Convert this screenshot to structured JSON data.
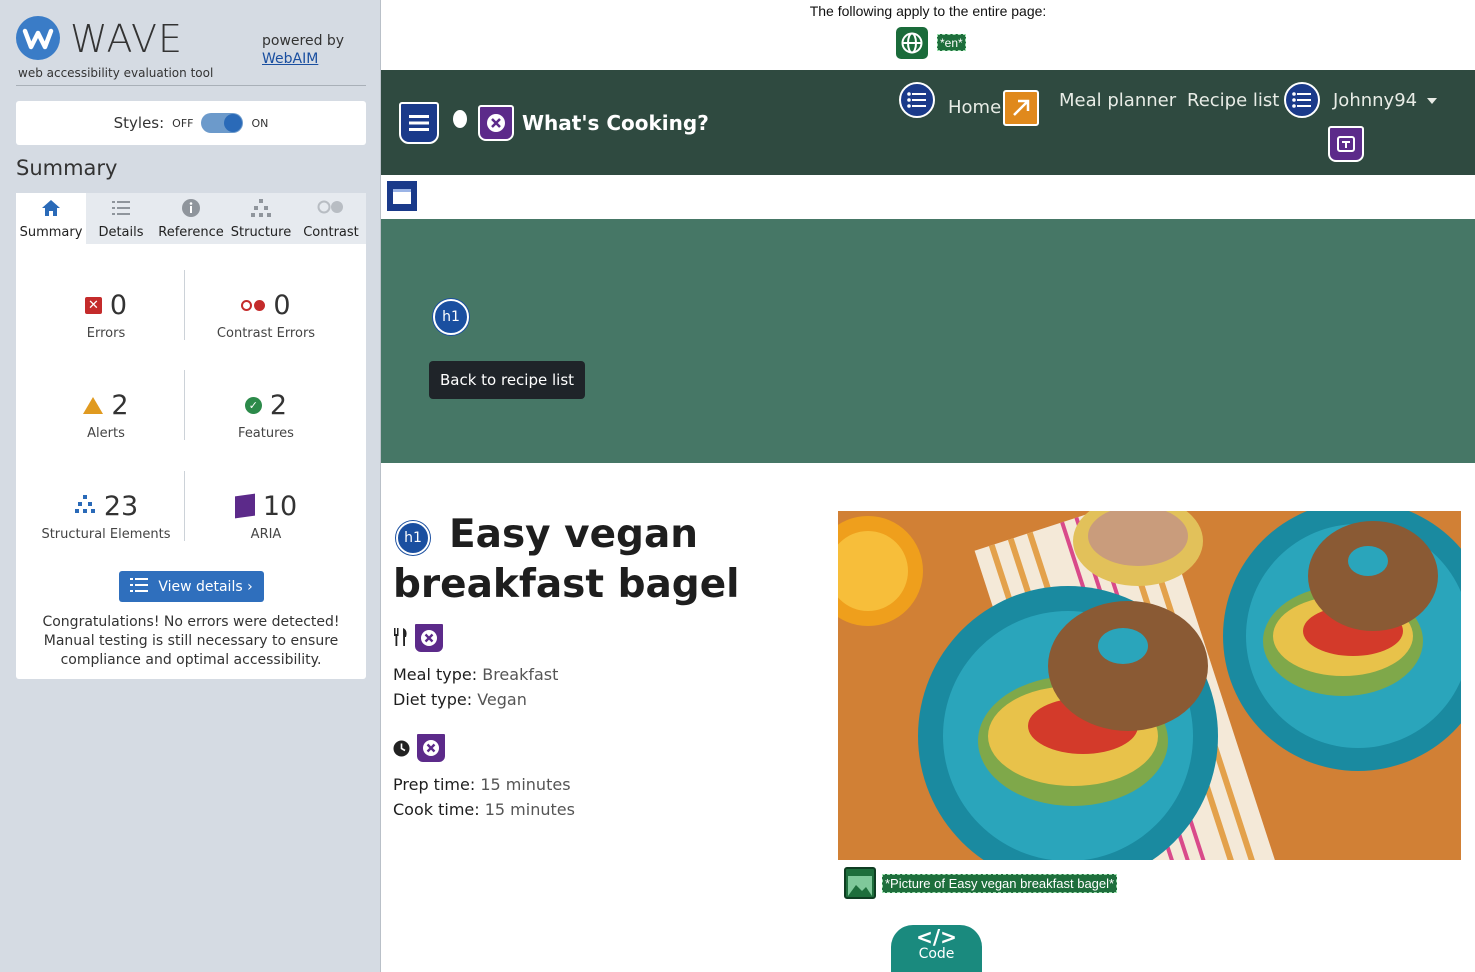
{
  "wave": {
    "logo_word": "WAVE",
    "logo_sub": "web accessibility evaluation tool",
    "powered_by": "powered by",
    "webaim_link": "WebAIM",
    "styles_label": "Styles:",
    "toggle_off": "OFF",
    "toggle_on": "ON",
    "summary_title": "Summary",
    "tabs": [
      {
        "label": "Summary",
        "icon": "home-icon",
        "active": true
      },
      {
        "label": "Details",
        "icon": "list-icon"
      },
      {
        "label": "Reference",
        "icon": "info-icon"
      },
      {
        "label": "Structure",
        "icon": "hierarchy-icon"
      },
      {
        "label": "Contrast",
        "icon": "contrast-icon"
      }
    ],
    "stats": {
      "errors": {
        "value": "0",
        "label": "Errors"
      },
      "contrast_errors": {
        "value": "0",
        "label": "Contrast Errors"
      },
      "alerts": {
        "value": "2",
        "label": "Alerts"
      },
      "features": {
        "value": "2",
        "label": "Features"
      },
      "structural": {
        "value": "23",
        "label": "Structural Elements"
      },
      "aria": {
        "value": "10",
        "label": "ARIA"
      }
    },
    "view_details": "View details ›",
    "congrats": "Congratulations! No errors were detected! Manual testing is still necessary to ensure compliance and optimal accessibility."
  },
  "page": {
    "apply_text": "The following apply to the entire page:",
    "lang_tag": "*en*",
    "brand": "What's Cooking?",
    "nav": {
      "home": "Home",
      "meal_planner": "Meal planner",
      "recipe_list": "Recipe list",
      "user": "Johnny94"
    },
    "back_button": "Back to recipe list",
    "h1_badge": "h1",
    "title": "Easy vegan breakfast bagel",
    "meal_type_label": "Meal type:",
    "meal_type_value": "Breakfast",
    "diet_type_label": "Diet type:",
    "diet_type_value": "Vegan",
    "prep_time_label": "Prep time:",
    "prep_time_value": "15 minutes",
    "cook_time_label": "Cook time:",
    "cook_time_value": "15 minutes",
    "image_alt": "*Picture of Easy vegan breakfast bagel*",
    "code_tab": "Code"
  },
  "colors": {
    "wave_blue": "#2f6fbd",
    "navbar": "#2f4a40",
    "hero": "#467766",
    "feature_green": "#1e6e3c",
    "aria_purple": "#5c2a8a"
  }
}
